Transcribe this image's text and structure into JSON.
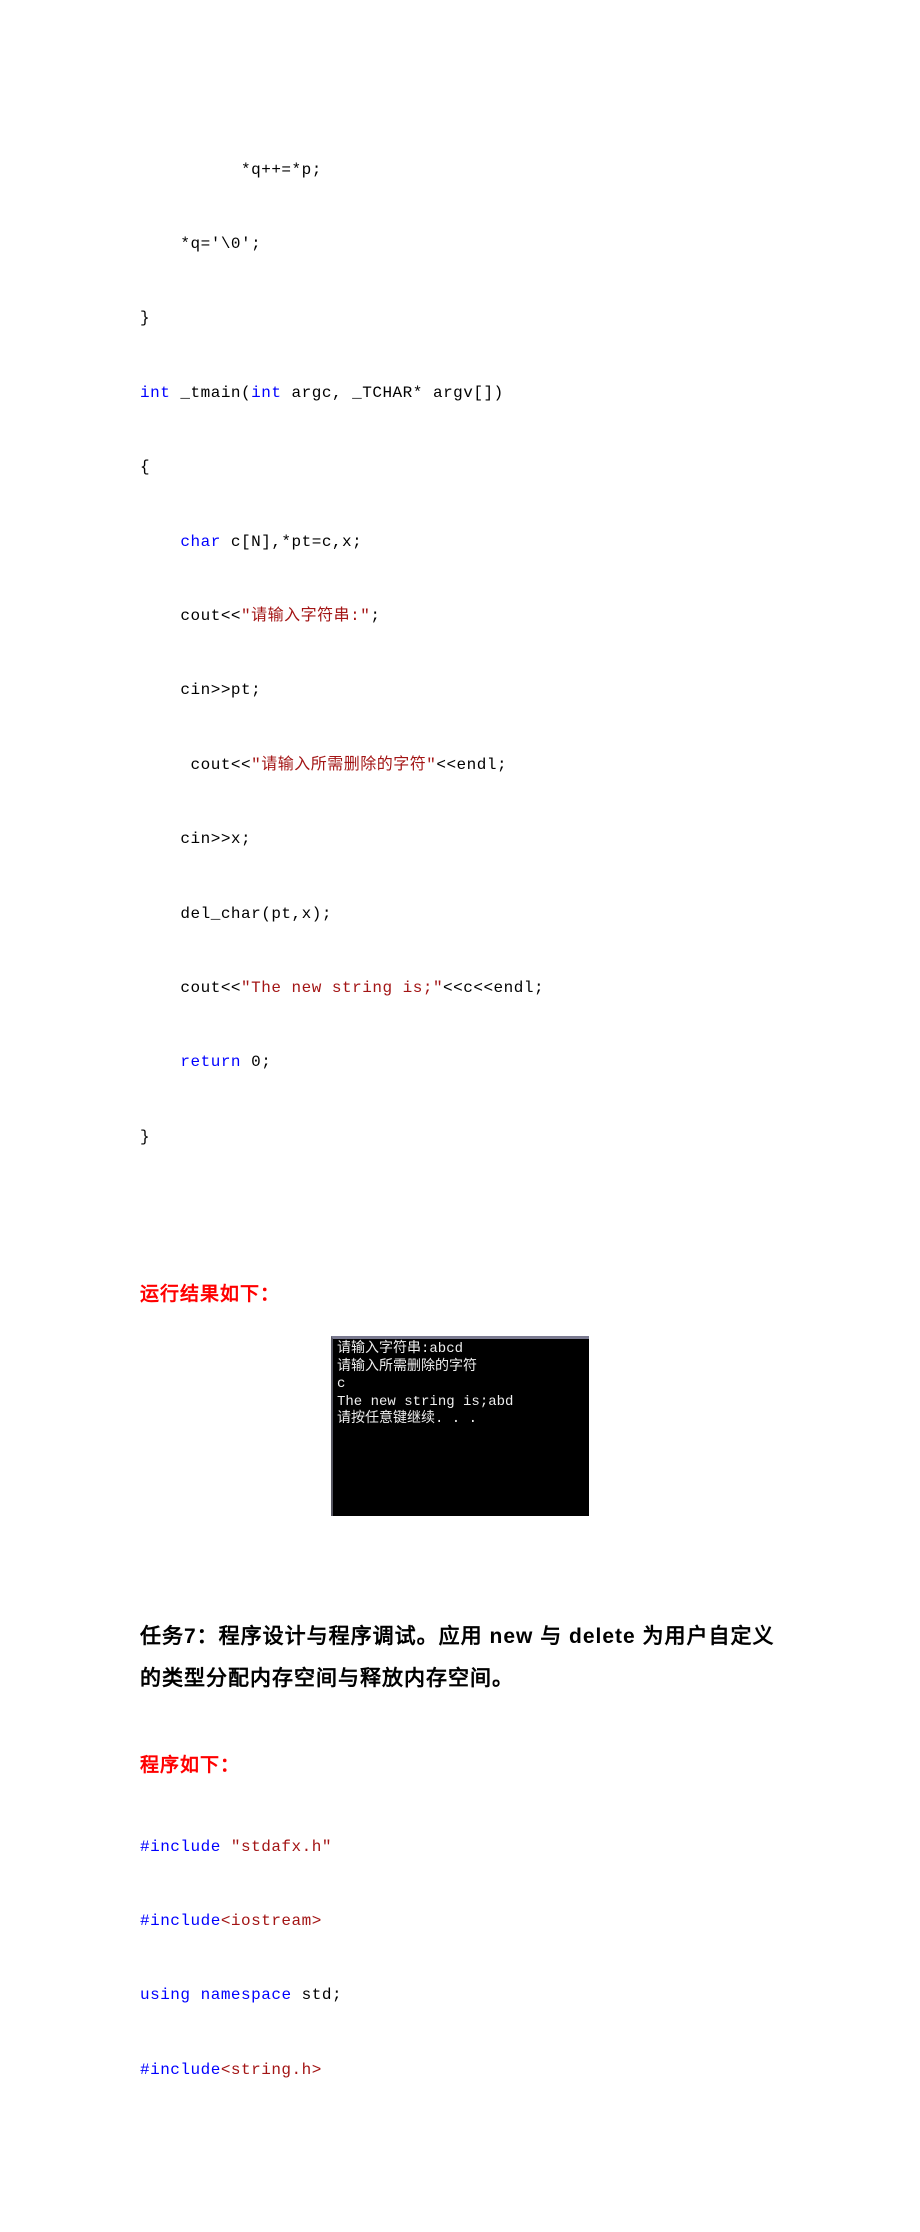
{
  "code1": {
    "l1": "          *q++=*p;",
    "l2": "    *q='\\0';",
    "l3": "}",
    "l4a": "int",
    "l4b": " _tmain(",
    "l4c": "int",
    "l4d": " argc, _TCHAR* argv[])",
    "l5": "{",
    "l6a": "    ",
    "l6b": "char",
    "l6c": " c[N],*pt=c,x;",
    "l7a": "    cout<<",
    "l7b": "\"请输入字符串:\"",
    "l7c": ";",
    "l8": "    cin>>pt;",
    "l9a": "     cout<<",
    "l9b": "\"请输入所需删除的字符\"",
    "l9c": "<<endl;",
    "l10": "    cin>>x;",
    "l11": "    del_char(pt,x);",
    "l12a": "    cout<<",
    "l12b": "\"The new string is;\"",
    "l12c": "<<c<<endl;",
    "l13a": "    ",
    "l13b": "return",
    "l13c": " 0;",
    "l14": "}"
  },
  "run_heading": "运行结果如下：",
  "terminal": {
    "l1": "请输入字符串:abcd",
    "l2": "请输入所需删除的字符",
    "l3": "c",
    "l4": "The new string is;abd",
    "l5": "请按任意键继续. . ."
  },
  "task_heading": "任务7：程序设计与程序调试。应用 new 与 delete 为用户自定义的类型分配内存空间与释放内存空间。",
  "code_heading": "程序如下：",
  "code2": {
    "l1a": "#include",
    "l1b": " \"stdafx.h\"",
    "l2a": "#include",
    "l2b": "<iostream>",
    "l3a": "using",
    "l3b": " ",
    "l3c": "namespace",
    "l3d": " std;",
    "l4a": "#include",
    "l4b": "<string.h>"
  }
}
